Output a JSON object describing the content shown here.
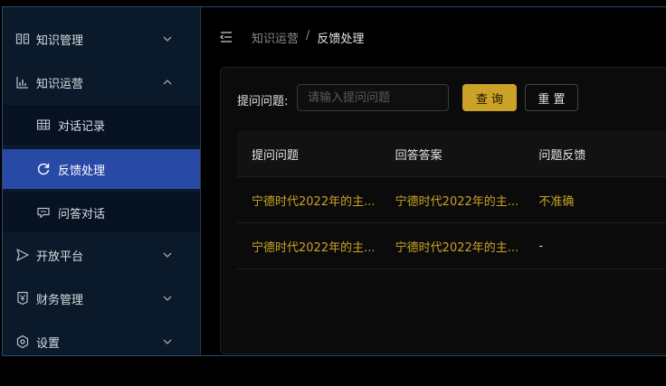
{
  "sidebar": {
    "items": [
      {
        "label": "知识管理",
        "icon": "book-icon"
      },
      {
        "label": "知识运营",
        "icon": "bar-chart-icon"
      },
      {
        "label": "对话记录",
        "icon": "table-icon"
      },
      {
        "label": "反馈处理",
        "icon": "refresh-icon"
      },
      {
        "label": "问答对话",
        "icon": "chat-icon"
      },
      {
        "label": "开放平台",
        "icon": "send-icon"
      },
      {
        "label": "财务管理",
        "icon": "finance-icon"
      },
      {
        "label": "设置",
        "icon": "gear-icon"
      }
    ]
  },
  "header": {
    "breadcrumb_parent": "知识运营",
    "breadcrumb_sep": "/",
    "breadcrumb_current": "反馈处理"
  },
  "filter": {
    "label": "提问问题:",
    "placeholder": "请输入提问问题",
    "value": "",
    "query_button": "查 询",
    "reset_button": "重 置"
  },
  "table": {
    "columns": [
      "提问问题",
      "回答答案",
      "问题反馈"
    ],
    "rows": [
      [
        "宁德时代2022年的主...",
        "宁德时代2022年的主...",
        "不准确"
      ],
      [
        "宁德时代2022年的主...",
        "宁德时代2022年的主...",
        "-"
      ]
    ]
  },
  "colors": {
    "accent": "#c9a227",
    "active_nav": "#2949a6",
    "sidebar_bg": "#0a1a2a"
  }
}
